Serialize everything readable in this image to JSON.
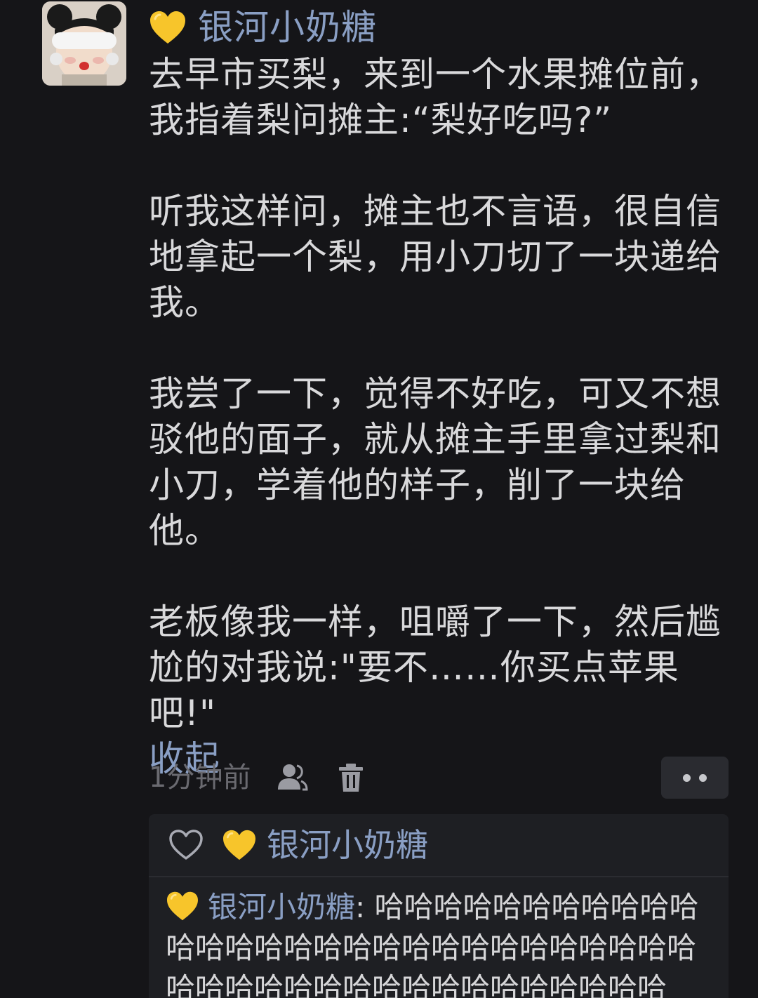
{
  "post": {
    "author_emoji": "💛",
    "author_name": "银河小奶糖",
    "paragraphs": [
      "去早市买梨，来到一个水果摊位前，\n我指着梨问摊主:“梨好吃吗?”",
      "听我这样问，摊主也不言语，很自信\n地拿起一个梨，用小刀切了一块递给\n我。",
      "我尝了一下，觉得不好吃，可又不想\n驳他的面子，就从摊主手里拿过梨和\n小刀，学着他的样子，削了一块给\n他。",
      "老板像我一样，咀嚼了一下，然后尴\n尬的对我说:\"要不……你买点苹果吧!\""
    ],
    "collapse_label": "收起",
    "time": "1分钟前"
  },
  "icons": {
    "avatar": "avatar-photo",
    "author_badge": "yellow-heart-icon",
    "visibility": "people-icon",
    "delete": "trash-icon",
    "more": "more-dots-icon",
    "like": "heart-outline-icon"
  },
  "replies": {
    "liker_name": "银河小奶糖",
    "reply_author": "银河小奶糖",
    "reply_separator": ":",
    "reply_text": "哈哈哈哈哈哈哈哈哈哈哈哈哈哈哈哈哈哈哈哈哈哈哈哈哈哈哈哈哈哈哈哈哈哈哈哈哈哈哈哈哈哈哈哈哈哈"
  },
  "colors": {
    "background": "#151518",
    "link": "#8a9fc4",
    "text": "#d9d9db",
    "muted": "#6a6a70",
    "panel": "#1e1f23",
    "heart": "#f7c52b"
  }
}
